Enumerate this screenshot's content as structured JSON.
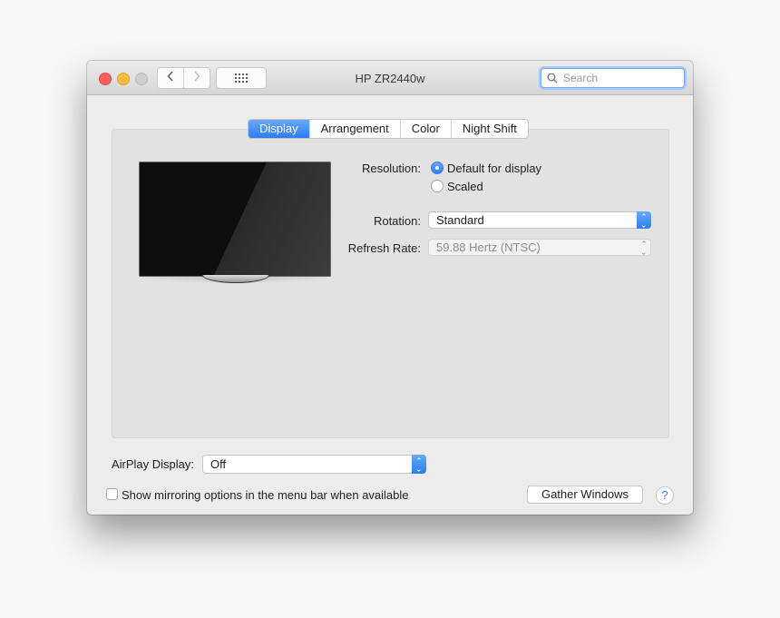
{
  "window": {
    "title": "HP ZR2440w",
    "search_placeholder": "Search",
    "nav": {
      "back_glyph": "‹",
      "forward_glyph": "›"
    }
  },
  "tabs": [
    {
      "label": "Display",
      "active": true
    },
    {
      "label": "Arrangement",
      "active": false
    },
    {
      "label": "Color",
      "active": false
    },
    {
      "label": "Night Shift",
      "active": false
    }
  ],
  "display": {
    "resolution_label": "Resolution:",
    "resolution_options": [
      {
        "label": "Default for display",
        "selected": true
      },
      {
        "label": "Scaled",
        "selected": false
      }
    ],
    "rotation_label": "Rotation:",
    "rotation_value": "Standard",
    "refresh_label": "Refresh Rate:",
    "refresh_value": "59.88 Hertz (NTSC)"
  },
  "footer": {
    "airplay_label": "AirPlay Display:",
    "airplay_value": "Off",
    "mirroring_checkbox_label": "Show mirroring options in the menu bar when available",
    "mirroring_checked": false,
    "gather_windows_label": "Gather Windows",
    "help_glyph": "?"
  },
  "colors": {
    "accent": "#2d7df2",
    "close": "#fc605c",
    "minimize": "#fdbc40",
    "zoom_disabled": "#cfcfcf"
  }
}
